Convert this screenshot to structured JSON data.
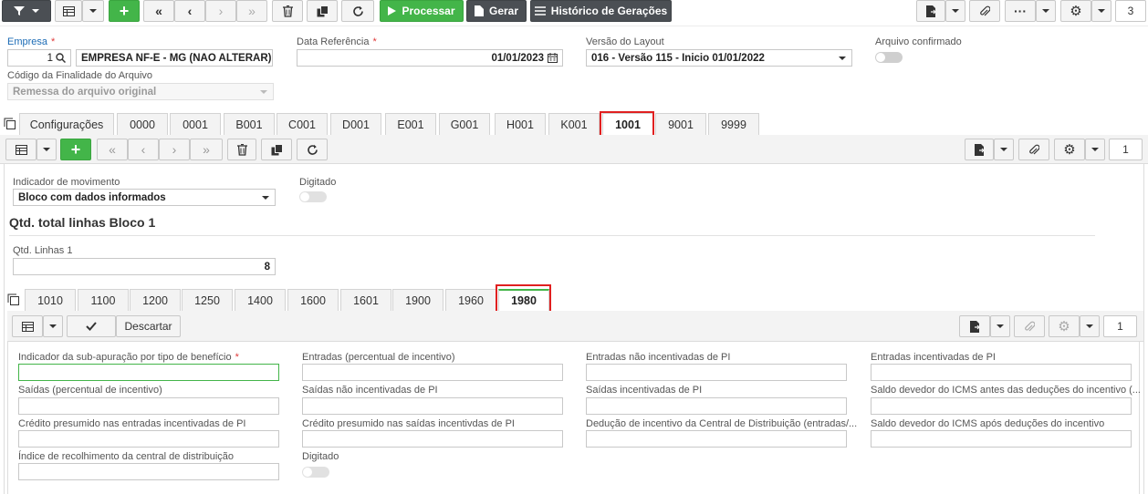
{
  "colors": {
    "accent_green": "#43b549",
    "dark_button": "#4b4f54",
    "highlight_red": "#e02020",
    "link_blue": "#1b6bb5"
  },
  "top_toolbar": {
    "process_label": "Processar",
    "generate_label": "Gerar",
    "history_label": "Histórico de Gerações",
    "record_count": "3"
  },
  "header_form": {
    "empresa": {
      "label": "Empresa",
      "code": "1",
      "name": "EMPRESA NF-E - MG (NAO ALTERAR)"
    },
    "data_referencia": {
      "label": "Data Referência",
      "value": "01/01/2023"
    },
    "versao_layout": {
      "label": "Versão do Layout",
      "value": "016 - Versão 115 - Inicio 01/01/2022"
    },
    "arquivo_confirmado": {
      "label": "Arquivo confirmado"
    },
    "codigo_finalidade": {
      "label": "Código da Finalidade do Arquivo",
      "value": "Remessa do arquivo original"
    }
  },
  "block_tabs": [
    {
      "label": "Configurações"
    },
    {
      "label": "0000"
    },
    {
      "label": "0001"
    },
    {
      "label": "B001"
    },
    {
      "label": "C001"
    },
    {
      "label": "D001"
    },
    {
      "label": "E001"
    },
    {
      "label": "G001"
    },
    {
      "label": "H001"
    },
    {
      "label": "K001"
    },
    {
      "label": "1001"
    },
    {
      "label": "9001"
    },
    {
      "label": "9999"
    }
  ],
  "block_toolbar": {
    "record_count": "1"
  },
  "block_form": {
    "indicador_movimento": {
      "label": "Indicador de movimento",
      "value": "Bloco com dados informados"
    },
    "digitado": {
      "label": "Digitado"
    },
    "section_title": "Qtd. total linhas Bloco 1",
    "qtd_linhas": {
      "label": "Qtd. Linhas 1",
      "value": "8"
    }
  },
  "register_tabs": [
    {
      "label": "1010"
    },
    {
      "label": "1100"
    },
    {
      "label": "1200"
    },
    {
      "label": "1250"
    },
    {
      "label": "1400"
    },
    {
      "label": "1600"
    },
    {
      "label": "1601"
    },
    {
      "label": "1900"
    },
    {
      "label": "1960"
    },
    {
      "label": "1980"
    }
  ],
  "register_toolbar": {
    "discard_label": "Descartar",
    "record_count": "1"
  },
  "register_form": {
    "f1": "Indicador da sub-apuração por tipo de benefício",
    "f2": "Entradas (percentual de incentivo)",
    "f3": "Entradas não incentivadas de PI",
    "f4": "Entradas incentivadas de PI",
    "f5": "Saídas (percentual de incentivo)",
    "f6": "Saídas não incentivadas de PI",
    "f7": "Saídas incentivadas de PI",
    "f8": "Saldo devedor do ICMS antes das deduções do incentivo (...",
    "f9": "Crédito presumido nas entradas incentivadas de PI",
    "f10": "Crédito presumido nas saídas incentivdas de PI",
    "f11": "Dedução de incentivo da Central de Distribuição (entradas/...",
    "f12": "Saldo devedor do ICMS após deduções do incentivo",
    "f13": "Índice de recolhimento da central de distribuição",
    "f14": "Digitado"
  }
}
